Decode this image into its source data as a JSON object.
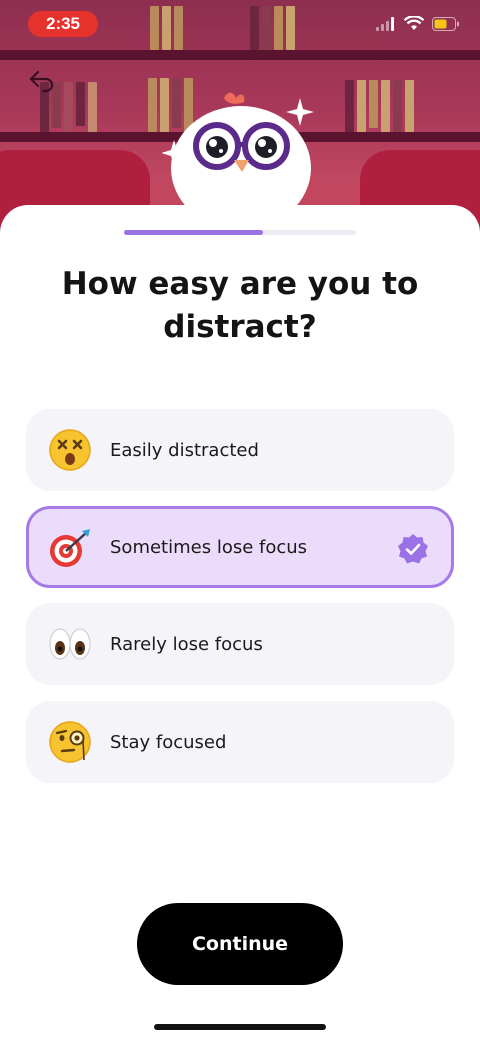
{
  "status_bar": {
    "time": "2:35"
  },
  "progress": {
    "fraction": 0.6
  },
  "question": {
    "title": "How easy are you to distract?"
  },
  "options": [
    {
      "label": "Easily distracted",
      "emoji": "dizzy-face-icon",
      "selected": false
    },
    {
      "label": "Sometimes lose focus",
      "emoji": "direct-hit-icon",
      "selected": true
    },
    {
      "label": "Rarely lose focus",
      "emoji": "eyes-icon",
      "selected": false
    },
    {
      "label": "Stay focused",
      "emoji": "monocle-face-icon",
      "selected": false
    }
  ],
  "continue_button": {
    "label": "Continue"
  },
  "colors": {
    "accent": "#9b72e6",
    "selected_bg": "#ecdcfb",
    "selected_border": "#a57ae8"
  }
}
